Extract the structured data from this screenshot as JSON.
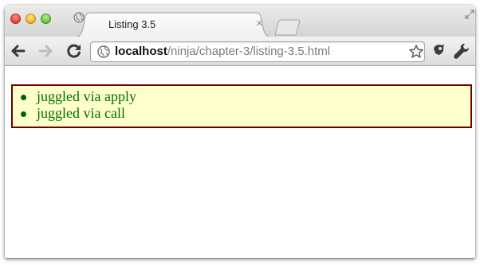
{
  "window": {
    "colors": {
      "accent_red": "#e0443a",
      "accent_yellow": "#f0b32a",
      "accent_green": "#5fc63a"
    }
  },
  "tab": {
    "title": "Listing 3.5",
    "close_glyph": "×",
    "icon": "globe-icon"
  },
  "toolbar": {
    "back_icon": "back-arrow-icon",
    "forward_icon": "forward-arrow-icon",
    "reload_icon": "reload-icon",
    "url_host": "localhost",
    "url_path": "/ninja/chapter-3/listing-3.5.html",
    "star_icon": "bookmark-star-icon",
    "extension_icon": "extension-icon",
    "menu_icon": "wrench-icon"
  },
  "page": {
    "results_border_color": "#6b0000",
    "results_background": "#ffffcc",
    "pass_color": "#007000",
    "results": [
      {
        "text": "juggled via apply"
      },
      {
        "text": "juggled via call"
      }
    ]
  }
}
